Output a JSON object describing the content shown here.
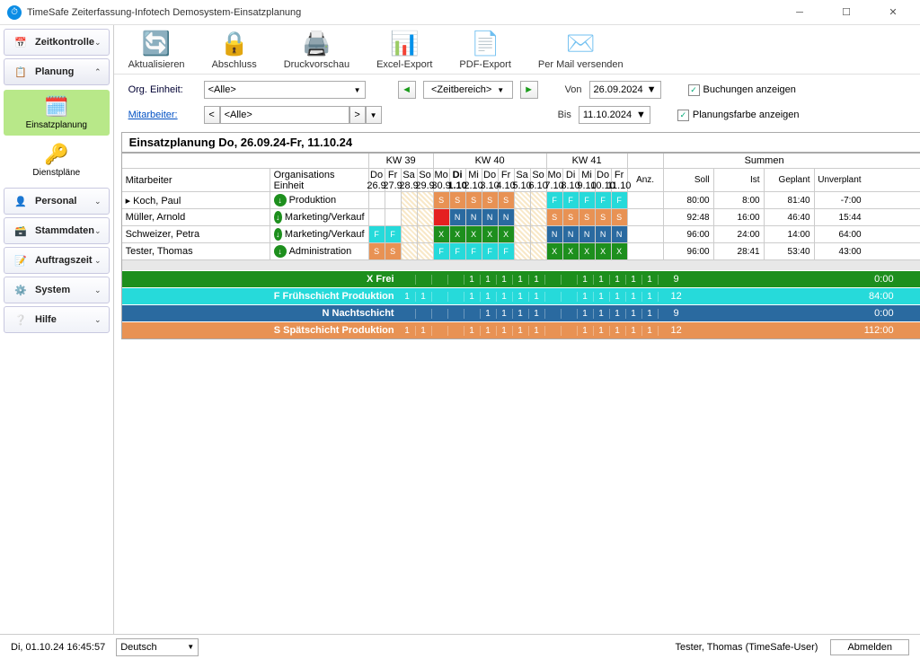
{
  "window": {
    "title": "TimeSafe Zeiterfassung-Infotech Demosystem-Einsatzplanung"
  },
  "sidebar": {
    "items": [
      {
        "label": "Zeitkontrolle",
        "icon": "📅"
      },
      {
        "label": "Planung",
        "icon": "📋"
      },
      {
        "label": "Personal",
        "icon": "👤"
      },
      {
        "label": "Stammdaten",
        "icon": "🗄️"
      },
      {
        "label": "Auftragszeit",
        "icon": "📝"
      },
      {
        "label": "System",
        "icon": "⚙️"
      },
      {
        "label": "Hilfe",
        "icon": "❔"
      }
    ],
    "sub": [
      {
        "label": "Einsatzplanung",
        "icon": "🗓️"
      },
      {
        "label": "Dienstpläne",
        "icon": "🔑"
      }
    ]
  },
  "toolbar": {
    "refresh": "Aktualisieren",
    "close": "Abschluss",
    "preview": "Druckvorschau",
    "excel": "Excel-Export",
    "pdf": "PDF-Export",
    "mail": "Per Mail versenden"
  },
  "filters": {
    "orgLabel": "Org. Einheit:",
    "orgValue": "<Alle>",
    "mitLabel": "Mitarbeiter:",
    "mitValue": "<Alle>",
    "range": "<Zeitbereich>",
    "vonLabel": "Von",
    "vonValue": "26.09.2024",
    "bisLabel": "Bis",
    "bisValue": "11.10.2024",
    "cb1": "Buchungen anzeigen",
    "cb2": "Planungsfarbe anzeigen"
  },
  "schedule": {
    "title": "Einsatzplanung  Do, 26.09.24-Fr, 11.10.24",
    "headers": {
      "mit": "Mitarbeiter",
      "org": "Organisations Einheit",
      "anz": "Anz.",
      "soll": "Soll",
      "ist": "Ist",
      "geplant": "Geplant",
      "unver": "Unverplant",
      "summen": "Summen"
    },
    "kw": [
      "KW 39",
      "KW 40",
      "KW 41"
    ],
    "days": [
      {
        "d": "Do",
        "n": "26.9"
      },
      {
        "d": "Fr",
        "n": "27.9"
      },
      {
        "d": "Sa",
        "n": "28.9"
      },
      {
        "d": "So",
        "n": "29.9"
      },
      {
        "d": "Mo",
        "n": "30.9"
      },
      {
        "d": "Di",
        "n": "1.10",
        "bold": true
      },
      {
        "d": "Mi",
        "n": "2.10"
      },
      {
        "d": "Do",
        "n": "3.10"
      },
      {
        "d": "Fr",
        "n": "4.10"
      },
      {
        "d": "Sa",
        "n": "5.10"
      },
      {
        "d": "So",
        "n": "6.10"
      },
      {
        "d": "Mo",
        "n": "7.10"
      },
      {
        "d": "Di",
        "n": "8.10"
      },
      {
        "d": "Mi",
        "n": "9.10"
      },
      {
        "d": "Do",
        "n": "10.10"
      },
      {
        "d": "Fr",
        "n": "11.10"
      }
    ],
    "rows": [
      {
        "name": "Koch, Paul",
        "org": "Produktion",
        "cells": [
          "",
          "",
          "h",
          "h",
          "S",
          "S",
          "S",
          "S",
          "S",
          "h",
          "h",
          "F",
          "F",
          "F",
          "F",
          "F"
        ],
        "soll": "80:00",
        "ist": "8:00",
        "gep": "81:40",
        "unv": "-7:00"
      },
      {
        "name": "Müller, Arnold",
        "org": "Marketing/Verkauf",
        "cells": [
          "",
          "",
          "h",
          "h",
          "r",
          "N",
          "N",
          "N",
          "N",
          "h",
          "h",
          "S",
          "S",
          "S",
          "S",
          "S"
        ],
        "soll": "92:48",
        "ist": "16:00",
        "gep": "46:40",
        "unv": "15:44"
      },
      {
        "name": "Schweizer, Petra",
        "org": "Marketing/Verkauf",
        "cells": [
          "F",
          "F",
          "h",
          "h",
          "X",
          "X",
          "X",
          "X",
          "X",
          "h",
          "h",
          "N",
          "N",
          "N",
          "N",
          "N"
        ],
        "soll": "96:00",
        "ist": "24:00",
        "gep": "14:00",
        "unv": "64:00"
      },
      {
        "name": "Tester, Thomas",
        "org": "Administration",
        "cells": [
          "S",
          "S",
          "h",
          "h",
          "F",
          "F",
          "F",
          "F",
          "F",
          "h",
          "h",
          "X",
          "X",
          "X",
          "X",
          "X"
        ],
        "soll": "96:00",
        "ist": "28:41",
        "gep": "53:40",
        "unv": "43:00"
      }
    ],
    "shifts": [
      {
        "label": "X Frei",
        "bg": "#1d8f1d",
        "cells": [
          "",
          "",
          "",
          "",
          "1",
          "1",
          "1",
          "1",
          "1",
          "",
          "",
          "1",
          "1",
          "1",
          "1",
          "1"
        ],
        "anz": "9",
        "val": "0:00"
      },
      {
        "label": "F Frühschicht Produktion",
        "bg": "#26dada",
        "cells": [
          "1",
          "1",
          "",
          "",
          "1",
          "1",
          "1",
          "1",
          "1",
          "",
          "",
          "1",
          "1",
          "1",
          "1",
          "1"
        ],
        "anz": "12",
        "val": "84:00"
      },
      {
        "label": "N Nachtschicht",
        "bg": "#2a6aa0",
        "cells": [
          "",
          "",
          "",
          "",
          "",
          "1",
          "1",
          "1",
          "1",
          "",
          "",
          "1",
          "1",
          "1",
          "1",
          "1"
        ],
        "anz": "9",
        "val": "0:00"
      },
      {
        "label": "S Spätschicht Produktion",
        "bg": "#e89254",
        "cells": [
          "1",
          "1",
          "",
          "",
          "1",
          "1",
          "1",
          "1",
          "1",
          "",
          "",
          "1",
          "1",
          "1",
          "1",
          "1"
        ],
        "anz": "12",
        "val": "112:00"
      }
    ]
  },
  "status": {
    "time": "Di, 01.10.24 16:45:57",
    "lang": "Deutsch",
    "user": "Tester, Thomas (TimeSafe-User)",
    "logout": "Abmelden"
  }
}
